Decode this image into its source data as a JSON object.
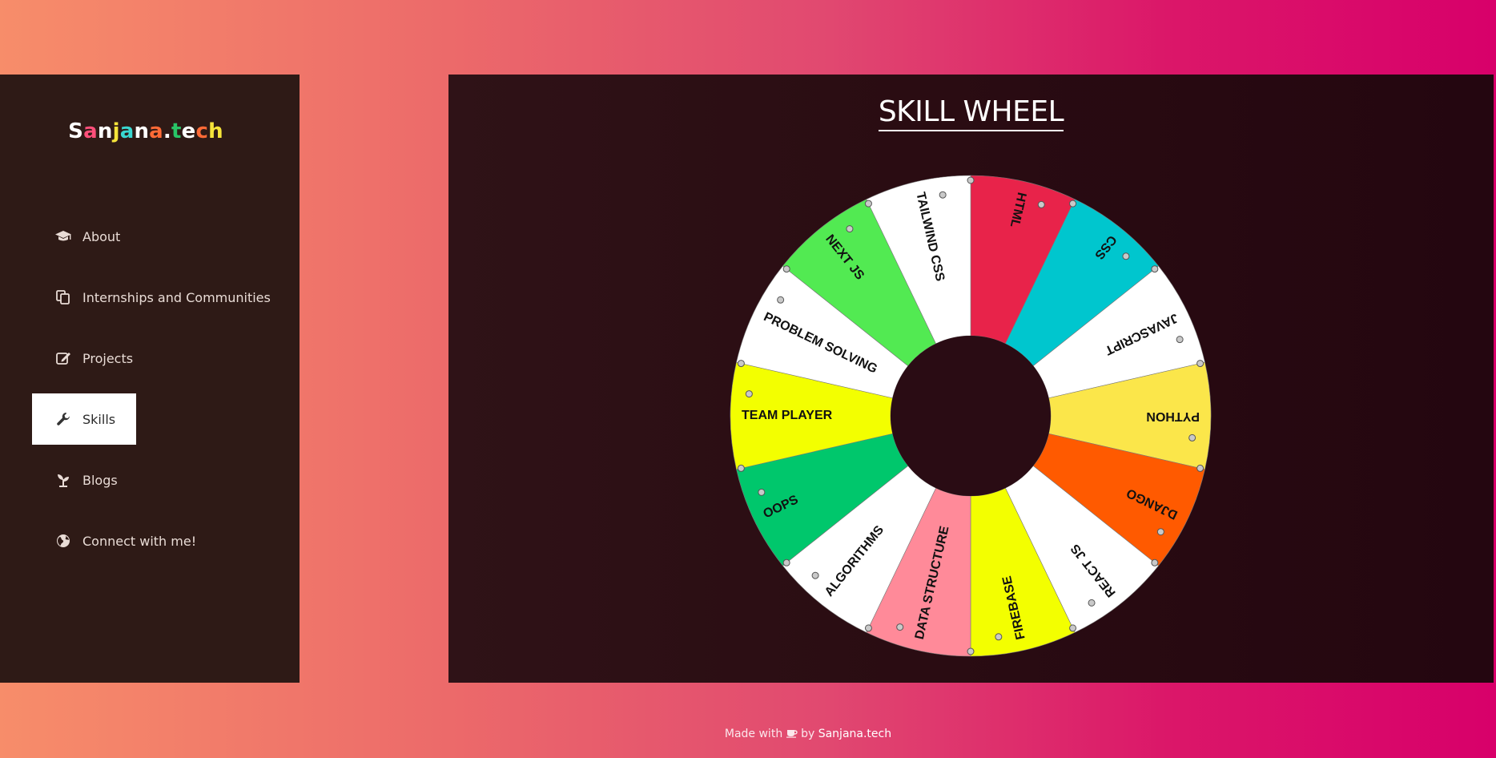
{
  "logo": {
    "letters": [
      {
        "ch": "S",
        "color": "#ffffff"
      },
      {
        "ch": "a",
        "color": "#ff4f7a"
      },
      {
        "ch": "n",
        "color": "#ffffff"
      },
      {
        "ch": "j",
        "color": "#f5e43a"
      },
      {
        "ch": "a",
        "color": "#39d7d0"
      },
      {
        "ch": "n",
        "color": "#ffffff"
      },
      {
        "ch": "a",
        "color": "#ff6a36"
      },
      {
        "ch": ".",
        "color": "#ffffff"
      },
      {
        "ch": "t",
        "color": "#28c466"
      },
      {
        "ch": "e",
        "color": "#ffffff"
      },
      {
        "ch": "c",
        "color": "#ff6a36"
      },
      {
        "ch": "h",
        "color": "#f5e43a"
      }
    ]
  },
  "nav": {
    "items": [
      {
        "label": "About",
        "icon": "graduation-cap-icon"
      },
      {
        "label": "Internships and Communities",
        "icon": "copy-icon"
      },
      {
        "label": "Projects",
        "icon": "edit-icon"
      },
      {
        "label": "Skills",
        "icon": "wrench-icon"
      },
      {
        "label": "Blogs",
        "icon": "seedling-icon"
      },
      {
        "label": "Connect with me!",
        "icon": "globe-icon"
      }
    ],
    "active_index": 3
  },
  "wheel": {
    "title": "SKILL WHEEL",
    "segments": [
      {
        "label": "HTML",
        "color": "#e8234a"
      },
      {
        "label": "CSS",
        "color": "#00c6ce"
      },
      {
        "label": "JAVASCRIPT",
        "color": "#ffffff"
      },
      {
        "label": "PYTHON",
        "color": "#fbe64a"
      },
      {
        "label": "DJANGO",
        "color": "#ff5a00"
      },
      {
        "label": "REACT JS",
        "color": "#ffffff"
      },
      {
        "label": "FIREBASE",
        "color": "#f3ff00"
      },
      {
        "label": "DATA STRUCTURE",
        "color": "#ff8a99"
      },
      {
        "label": "ALGORITHMS",
        "color": "#ffffff"
      },
      {
        "label": "OOPS",
        "color": "#00c76c"
      },
      {
        "label": "TEAM PLAYER",
        "color": "#f3ff00"
      },
      {
        "label": "PROBLEM SOLVING",
        "color": "#ffffff"
      },
      {
        "label": "NEXT JS",
        "color": "#52ea52"
      },
      {
        "label": "TAILWIND CSS",
        "color": "#ffffff"
      }
    ]
  },
  "footer": {
    "prefix": "Made with",
    "icon": "coffee-icon",
    "by": "by",
    "brand": "Sanjana.tech"
  }
}
